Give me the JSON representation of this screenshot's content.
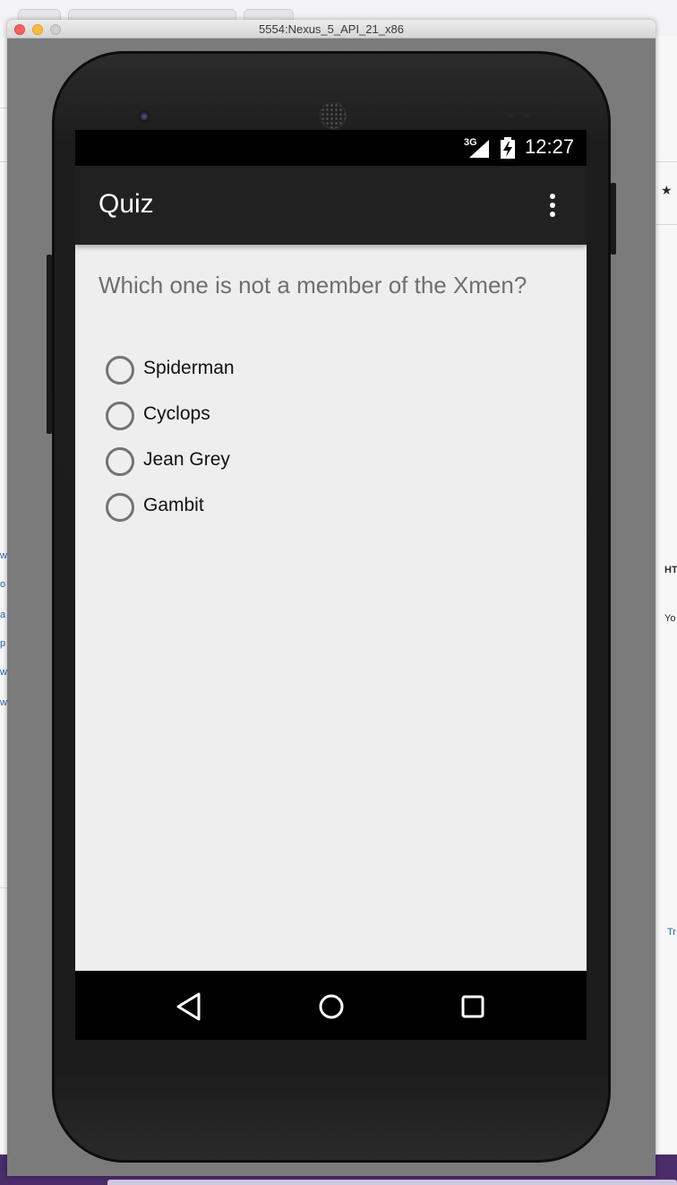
{
  "emulator": {
    "window_title": "5554:Nexus_5_API_21_x86"
  },
  "status_bar": {
    "network": "3G",
    "time": "12:27"
  },
  "app_bar": {
    "title": "Quiz",
    "menu_icon": "overflow-menu-icon"
  },
  "quiz": {
    "question": "Which one is not a member of the Xmen?",
    "options": [
      {
        "label": "Spiderman",
        "selected": false
      },
      {
        "label": "Cyclops",
        "selected": false
      },
      {
        "label": "Jean Grey",
        "selected": false
      },
      {
        "label": "Gambit",
        "selected": false
      }
    ]
  },
  "nav_bar": {
    "back_icon": "back-triangle-icon",
    "home_icon": "home-circle-icon",
    "recents_icon": "recents-square-icon"
  },
  "colors": {
    "app_bar": "#212121",
    "screen_bg": "#eeeeee",
    "question_text": "#6f6f6f",
    "radio_ring": "#737373"
  }
}
